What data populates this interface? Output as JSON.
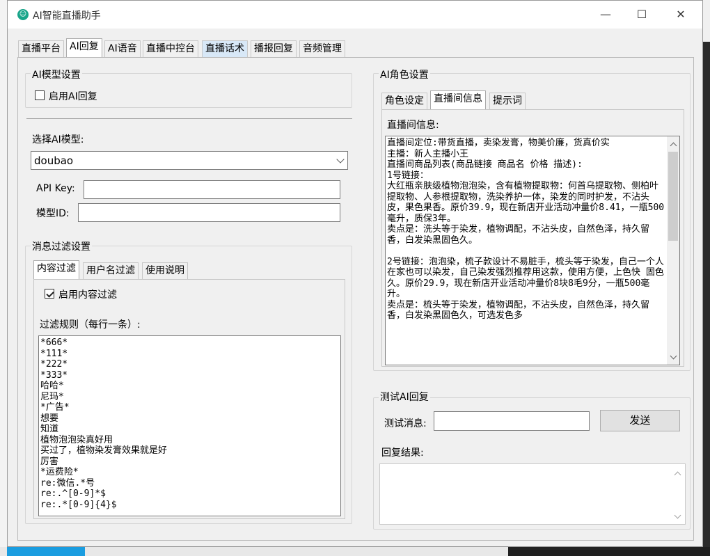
{
  "window": {
    "title": "AI智能直播助手",
    "minimize": "—",
    "maximize": "☐",
    "close": "✕"
  },
  "tabs": [
    "直播平台",
    "AI回复",
    "AI语音",
    "直播中控台",
    "直播话术",
    "播报回复",
    "音频管理"
  ],
  "model_settings": {
    "title": "AI模型设置",
    "enable_label": "启用AI回复",
    "enable_checked": false,
    "select_label": "选择AI模型:",
    "selected_model": "doubao",
    "api_key_label": "API Key:",
    "api_key_value": "",
    "model_id_label": "模型ID:",
    "model_id_value": ""
  },
  "filter_settings": {
    "title": "消息过滤设置",
    "subtabs": [
      "内容过滤",
      "用户名过滤",
      "使用说明"
    ],
    "enable_label": "启用内容过滤",
    "enable_checked": true,
    "rules_label": "过滤规则（每行一条）:",
    "rules_text": "*666*\n*111*\n*222*\n*333*\n哈哈*\n尼玛*\n*广告*\n想要\n知道\n植物泡泡染真好用\n买过了，植物染发膏效果就是好\n厉害\n*运费险*\nre:微信.*号\nre:.^[0-9]*$\nre:.*[0-9]{4}$"
  },
  "role_settings": {
    "title": "AI角色设置",
    "subtabs": [
      "角色设定",
      "直播间信息",
      "提示词"
    ],
    "room_info_label": "直播间信息:",
    "room_info_text": "直播间定位:带货直播，卖染发膏，物美价廉，货真价实\n主播：新人主播小王\n直播间商品列表(商品链接 商品名 价格 描述):\n1号链接：\n大红瓶亲肤级植物泡泡染，含有植物提取物：何首乌提取物、侧柏叶提取物、人参根提取物，洗染养护一体，染发的同时护发，不沾头皮，果色果香。原价39.9，现在新店开业活动冲量价8.41，一瓶500毫升，质保3年。\n卖点是：洗头等于染发，植物调配，不沾头皮，自然色泽，持久留香，白发染黑固色久。\n\n2号链接：泡泡染，梳子款设计不易脏手，梳头等于染发，自己一个人在家也可以染发，自己染发强烈推荐用这款，使用方便，上色快 固色久。原价29.9，现在新店开业活动冲量价8块8毛9分，一瓶500毫升。\n卖点是：梳头等于染发，植物调配，不沾头皮，自然色泽，持久留香，白发染黑固色久，可选发色多"
  },
  "test_ai": {
    "title": "测试AI回复",
    "message_label": "测试消息:",
    "message_value": "",
    "send_button": "发送",
    "result_label": "回复结果:",
    "result_text": ""
  },
  "colors": {
    "app_icon": "#1aa58a",
    "tab_highlight": "#d8e8f7"
  }
}
